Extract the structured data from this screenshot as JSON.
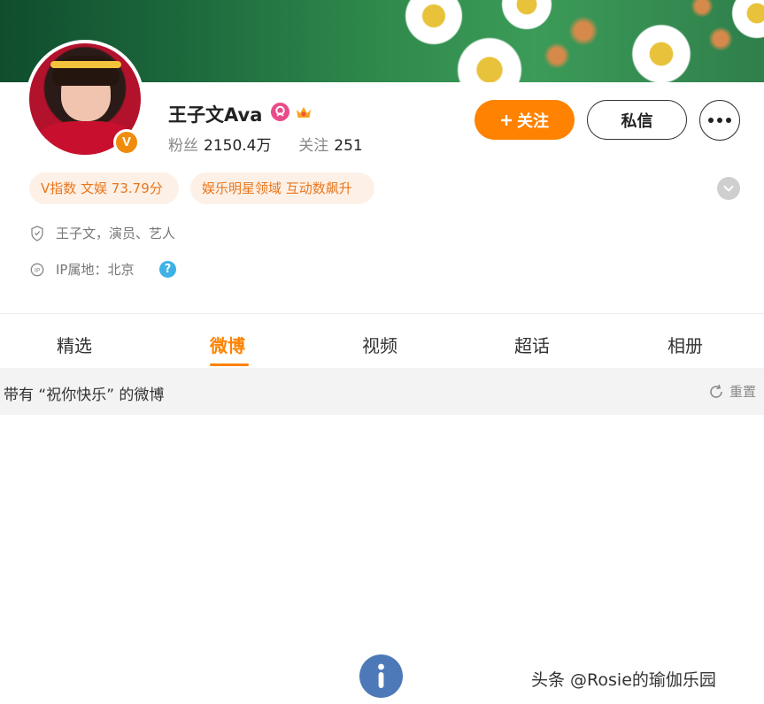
{
  "profile": {
    "name": "王子文Ava",
    "verified_badge": "V",
    "fans_label": "粉丝",
    "fans_value": "2150.4万",
    "following_label": "关注",
    "following_value": "251",
    "icons": [
      "svip-icon",
      "crown-icon",
      "verified-icon"
    ]
  },
  "actions": {
    "follow_label": "关注",
    "message_label": "私信",
    "more": "more-icon"
  },
  "tags": [
    {
      "label": "V指数 文娱 73.79分"
    },
    {
      "label": "娱乐明星领域 互动数飙升"
    }
  ],
  "info": {
    "description": "王子文，演员、艺人",
    "ip_location": "IP属地：北京",
    "help": "?"
  },
  "tabs": [
    {
      "label": "精选"
    },
    {
      "label": "微博"
    },
    {
      "label": "视频"
    },
    {
      "label": "超话"
    },
    {
      "label": "相册"
    }
  ],
  "active_tab": "微博",
  "filter": {
    "text": "带有 “祝你快乐” 的微博",
    "reset_label": "重置"
  },
  "fab": {
    "glyph": "i"
  },
  "watermark": "头条 @Rosie的瑜伽乐园",
  "colors": {
    "accent": "#ff8200",
    "tag_bg": "#fdf1e7",
    "tag_text": "#e9761c",
    "fab": "#4d79b8",
    "help": "#3eb1e6"
  }
}
